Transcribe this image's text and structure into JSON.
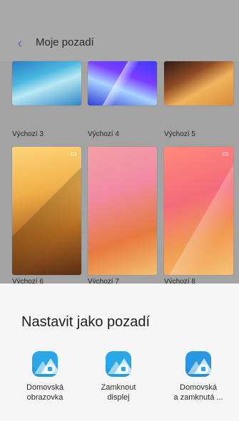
{
  "header": {
    "title": "Moje pozadí"
  },
  "wallpapers": {
    "row1": [
      {
        "label": "Výchozí 3"
      },
      {
        "label": "Výchozí 4"
      },
      {
        "label": "Výchozí 5"
      }
    ],
    "row2": [
      {
        "label": "Výchozí 6"
      },
      {
        "label": "Výchozí 7"
      },
      {
        "label": "Výchozí 8"
      }
    ]
  },
  "sheet": {
    "title": "Nastavit jako pozadí",
    "options": [
      {
        "label_line1": "Domovská",
        "label_line2": "obrazovka",
        "icon": "home-screen-icon"
      },
      {
        "label_line1": "Zamknout",
        "label_line2": "displej",
        "icon": "lock-screen-icon"
      },
      {
        "label_line1": "Domovská",
        "label_line2": "a zamknutá ...",
        "icon": "home-and-lock-icon"
      }
    ]
  },
  "colors": {
    "accent": "#6a5ad0",
    "sheet_bg": "#f6f6f6",
    "icon_blue": "#2aa7e6"
  }
}
